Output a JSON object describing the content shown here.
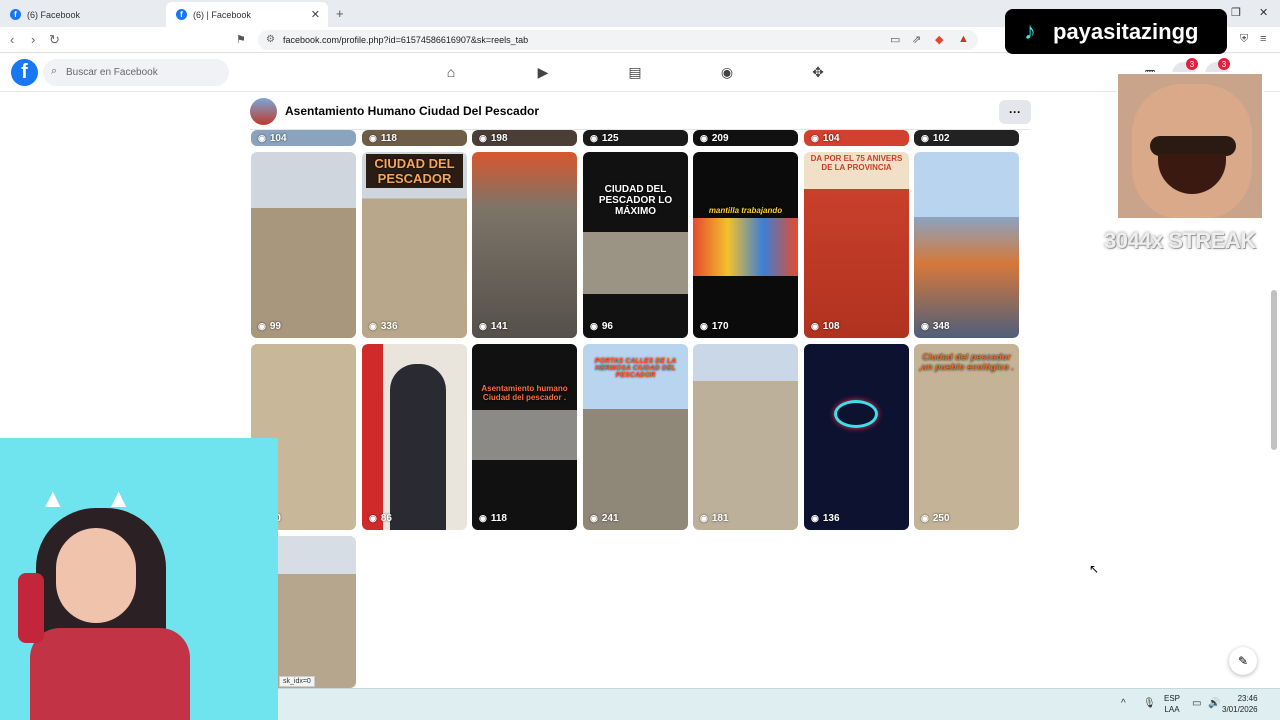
{
  "browser": {
    "tabs": [
      {
        "label": "(6) Facebook",
        "active": false
      },
      {
        "label": "(6) | Facebook",
        "active": true
      }
    ],
    "url": "facebook.com/profile.php?id=61574586616907&sk=reels_tab",
    "new_tab": "+",
    "status_link": "sk_idx=0"
  },
  "fb": {
    "logo": "f",
    "search_placeholder": "Buscar en Facebook",
    "nav_icons": [
      "home-icon",
      "video-icon",
      "marketplace-icon",
      "groups-icon",
      "gaming-icon"
    ],
    "badge_messenger": "3",
    "badge_notifications": "3"
  },
  "profile": {
    "name": "Asentamiento Humano Ciudad Del Pescador",
    "more": "···"
  },
  "reels_top_row": [
    {
      "views": "104"
    },
    {
      "views": "118"
    },
    {
      "views": "198"
    },
    {
      "views": "125"
    },
    {
      "views": "209"
    },
    {
      "views": "104"
    },
    {
      "views": "102"
    }
  ],
  "reels_row2": [
    {
      "views": "99",
      "caption": "",
      "bg": "#a8967d"
    },
    {
      "views": "336",
      "caption": "CIUDAD DEL PESCADOR",
      "bg": "#b8a78a"
    },
    {
      "views": "141",
      "caption": "",
      "bg": "#7d7468"
    },
    {
      "views": "96",
      "caption": "CIUDAD DEL PESCADOR LO MÁXIMO",
      "bg": "#111111"
    },
    {
      "views": "170",
      "caption": "mantilla trabajando",
      "bg": "#0b0b0b"
    },
    {
      "views": "108",
      "caption": "DA POR EL 75 ANIVERS DE LA PROVINCIA",
      "bg": "#c9402a"
    },
    {
      "views": "348",
      "caption": "",
      "bg": "#8aa4c0"
    }
  ],
  "reels_row3": [
    {
      "views": "30",
      "caption": "",
      "bg": "#c9b79a"
    },
    {
      "views": "86",
      "caption": "",
      "bg": "#3a3a46"
    },
    {
      "views": "118",
      "caption": "Asentamiento humano Ciudad del pescador .",
      "bg": "#111111"
    },
    {
      "views": "241",
      "caption": "PORTAS CALLES DE LA HERMOSA CIUDAD DEL PESCADOR",
      "bg": "#8f8778"
    },
    {
      "views": "181",
      "caption": "",
      "bg": "#bdb09a"
    },
    {
      "views": "136",
      "caption": "",
      "bg": "#0d1230"
    },
    {
      "views": "250",
      "caption": "Ciudad del pescador ,un pueblo ecológico .",
      "bg": "#c4b397"
    }
  ],
  "reels_row4": [
    {
      "views": "",
      "caption": "",
      "bg": "#b5a68d"
    }
  ],
  "overlays": {
    "tiktok_name": "payasitazingg",
    "streak": "3044x STREAK"
  },
  "taskbar": {
    "lang_line1": "ESP",
    "lang_line2": "LAA",
    "time": "23:46",
    "date": "3/01/2026"
  }
}
